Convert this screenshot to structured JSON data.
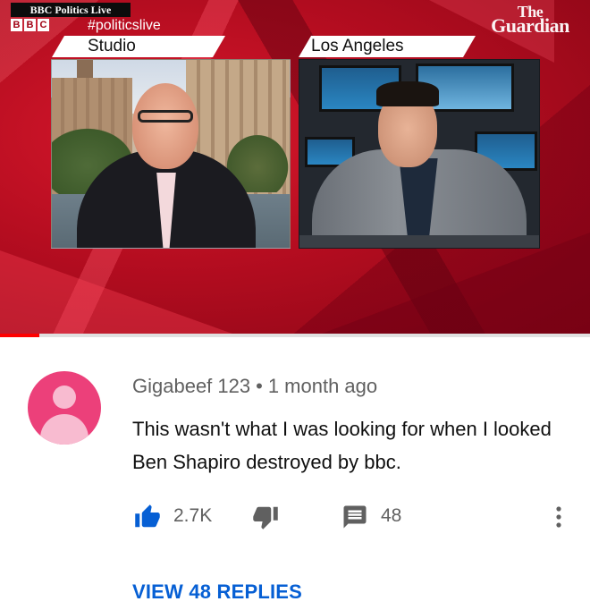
{
  "video": {
    "banner": "BBC Politics Live",
    "bbc_logo": [
      "B",
      "B",
      "C"
    ],
    "hashtag": "#politicslive",
    "guardian_logo": {
      "line1": "The",
      "line2": "Guardian"
    },
    "left_panel_label": "Studio",
    "right_panel_label": "Los Angeles",
    "progress_fraction": 0.067,
    "colors": {
      "background": "#b50d20",
      "progress": "#ff0000"
    }
  },
  "comment": {
    "avatar_icon": "user-avatar-icon",
    "author": "Gigabeef 123",
    "separator": "•",
    "time": "1 month ago",
    "text": "This wasn't what I was looking for when I looked Ben Shapiro destroyed by bbc.",
    "likes": "2.7K",
    "replies_count": "48",
    "view_replies": "VIEW 48 REPLIES",
    "colors": {
      "avatar": "#ec407a",
      "link": "#065fd4",
      "icon": "#065fd4",
      "muted_icon": "#606060"
    }
  }
}
